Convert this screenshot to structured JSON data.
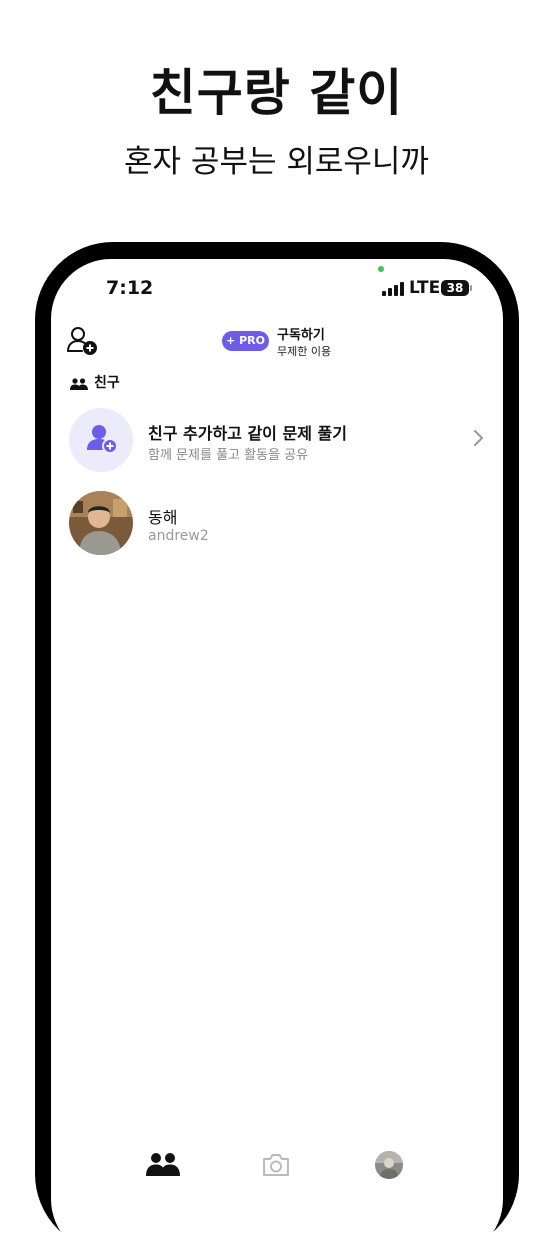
{
  "promo": {
    "headline": "친구랑 같이",
    "subheadline": "혼자 공부는 외로우니까"
  },
  "status_bar": {
    "time": "7:12",
    "network": "LTE",
    "battery": "38"
  },
  "header": {
    "pro_badge": "+ PRO",
    "subscribe_title": "구독하기",
    "subscribe_subtitle": "무제한 이용"
  },
  "friends_section": {
    "label": "친구",
    "add_friend": {
      "title": "친구 추가하고 같이 문제 풀기",
      "subtitle": "함께 문제를 풀고 활동을 공유"
    },
    "friends": [
      {
        "name": "동해",
        "username": "andrew2"
      }
    ]
  },
  "tab_bar": {
    "tabs": [
      {
        "name": "friends",
        "icon": "people-icon",
        "active": true
      },
      {
        "name": "camera",
        "icon": "camera-icon",
        "active": false
      },
      {
        "name": "profile",
        "icon": "avatar",
        "active": false
      }
    ]
  },
  "colors": {
    "accent": "#6c5ce7",
    "add_avatar_bg": "#ecebfb",
    "phone_frame": "#000000"
  }
}
